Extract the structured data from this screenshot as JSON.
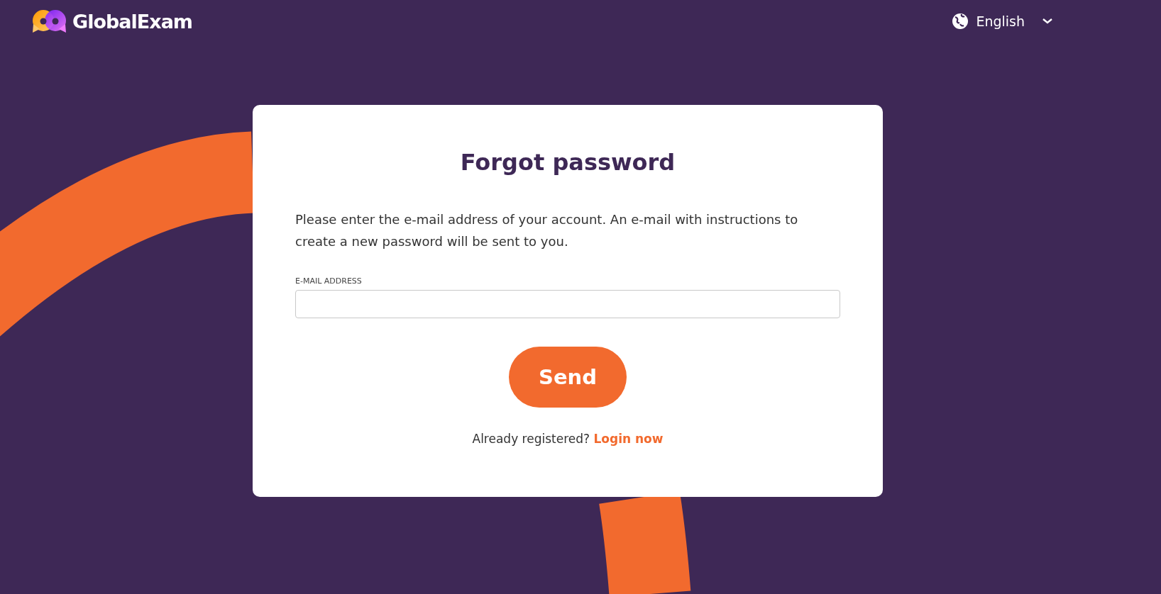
{
  "header": {
    "logo_text": "GlobalExam",
    "language": {
      "label": "English"
    }
  },
  "card": {
    "title": "Forgot password",
    "instructions": "Please enter the e-mail address of your account. An e-mail with instructions to create a new password will be sent to you.",
    "email_field": {
      "label": "E-MAIL ADDRESS"
    },
    "submit_button": "Send",
    "login_prompt": {
      "text": "Already registered?",
      "link": "Login now"
    }
  }
}
